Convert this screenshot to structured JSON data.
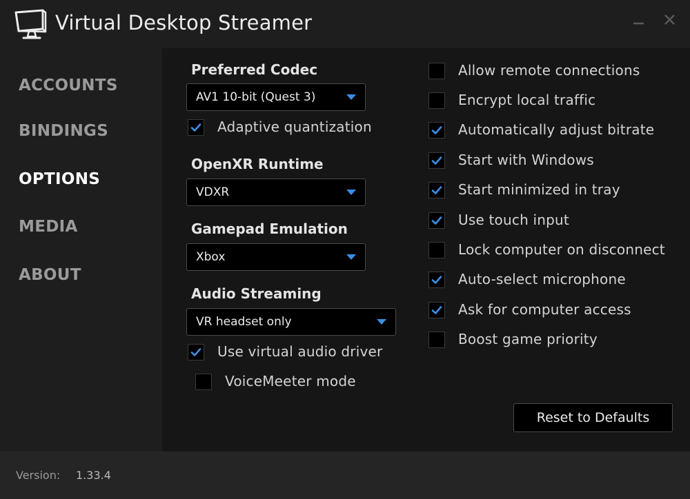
{
  "window": {
    "title": "Virtual Desktop Streamer",
    "logo_icon": "monitor-icon",
    "minimize_icon": "minimize-icon",
    "close_icon": "close-icon"
  },
  "sidebar": {
    "items": [
      {
        "label": "ACCOUNTS",
        "active": false
      },
      {
        "label": "BINDINGS",
        "active": false
      },
      {
        "label": "OPTIONS",
        "active": true
      },
      {
        "label": "MEDIA",
        "active": false
      },
      {
        "label": "ABOUT",
        "active": false
      }
    ]
  },
  "options": {
    "codec": {
      "label": "Preferred Codec",
      "value": "AV1 10-bit (Quest 3)"
    },
    "adaptive_quantization": {
      "label": "Adaptive quantization",
      "checked": true
    },
    "openxr": {
      "label": "OpenXR Runtime",
      "value": "VDXR"
    },
    "gamepad": {
      "label": "Gamepad Emulation",
      "value": "Xbox"
    },
    "audio": {
      "label": "Audio Streaming",
      "value": "VR headset only"
    },
    "virtual_audio": {
      "label": "Use virtual audio driver",
      "checked": true
    },
    "voicemeeter": {
      "label": "VoiceMeeter mode",
      "checked": false
    },
    "right_checks": [
      {
        "label": "Allow remote connections",
        "checked": false
      },
      {
        "label": "Encrypt local traffic",
        "checked": false
      },
      {
        "label": "Automatically adjust bitrate",
        "checked": true
      },
      {
        "label": "Start with Windows",
        "checked": true
      },
      {
        "label": "Start minimized in tray",
        "checked": true
      },
      {
        "label": "Use touch input",
        "checked": true
      },
      {
        "label": "Lock computer on disconnect",
        "checked": false
      },
      {
        "label": "Auto-select microphone",
        "checked": true
      },
      {
        "label": "Ask for computer access",
        "checked": true
      },
      {
        "label": "Boost game priority",
        "checked": false
      }
    ],
    "reset_label": "Reset to Defaults"
  },
  "footer": {
    "version_label": "Version:",
    "version_value": "1.33.4"
  },
  "colors": {
    "accent": "#3a8ee6",
    "background": "#1e1e1e",
    "panel": "#161616"
  }
}
